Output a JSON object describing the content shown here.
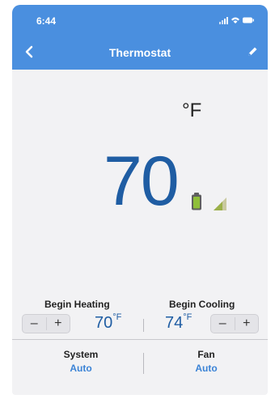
{
  "status_bar": {
    "time": "6:44"
  },
  "header": {
    "title": "Thermostat"
  },
  "display": {
    "unit": "°F",
    "current_temp": "70"
  },
  "heating": {
    "label": "Begin Heating",
    "value": "70",
    "unit": "°F",
    "minus": "–",
    "plus": "+"
  },
  "cooling": {
    "label": "Begin Cooling",
    "value": "74",
    "unit": "°F",
    "minus": "–",
    "plus": "+"
  },
  "system": {
    "label": "System",
    "value": "Auto"
  },
  "fan": {
    "label": "Fan",
    "value": "Auto"
  },
  "colors": {
    "header_bg": "#4a8fdf",
    "temp_text": "#1f5da3",
    "accent": "#3b83d6",
    "battery": "#8fbf3a"
  }
}
